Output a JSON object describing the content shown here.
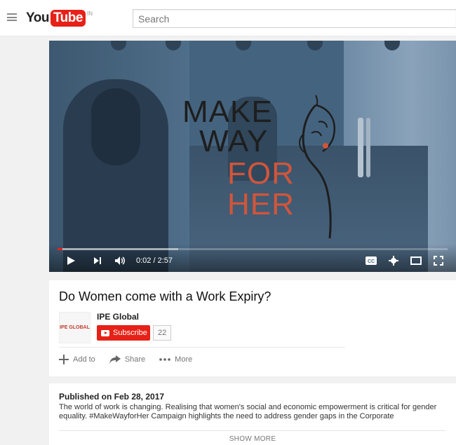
{
  "masthead": {
    "logo_you": "You",
    "logo_tube": "Tube",
    "logo_country": "IN",
    "search_placeholder": "Search"
  },
  "player": {
    "overlay_text": {
      "line1": "MAKE",
      "line2": "WAY",
      "line3": "FOR",
      "line4": "HER"
    },
    "time_display": "0:02 / 2:57",
    "played_fraction": 0.012,
    "buffered_fraction": 0.31,
    "colors": {
      "progress": "#e62117",
      "brand_orange": "#d2553a"
    },
    "controls": [
      "play-icon",
      "next-icon",
      "volume-icon",
      "captions-icon",
      "settings-icon",
      "theater-icon",
      "fullscreen-icon"
    ]
  },
  "video": {
    "title": "Do Women come with a Work Expiry?",
    "channel_name": "IPE Global",
    "channel_thumb_text": "IPE GLOBAL",
    "subscribe_label": "Subscribe",
    "subscriber_count": "22",
    "actions": {
      "add_to": "Add to",
      "share": "Share",
      "more": "More"
    }
  },
  "description": {
    "published": "Published on Feb 28, 2017",
    "text": "The world of work is changing. Realising that women's social and economic empowerment is critical for gender equality. #MakeWayforHer Campaign highlights the need to address gender gaps in the Corporate",
    "show_more": "SHOW MORE"
  }
}
